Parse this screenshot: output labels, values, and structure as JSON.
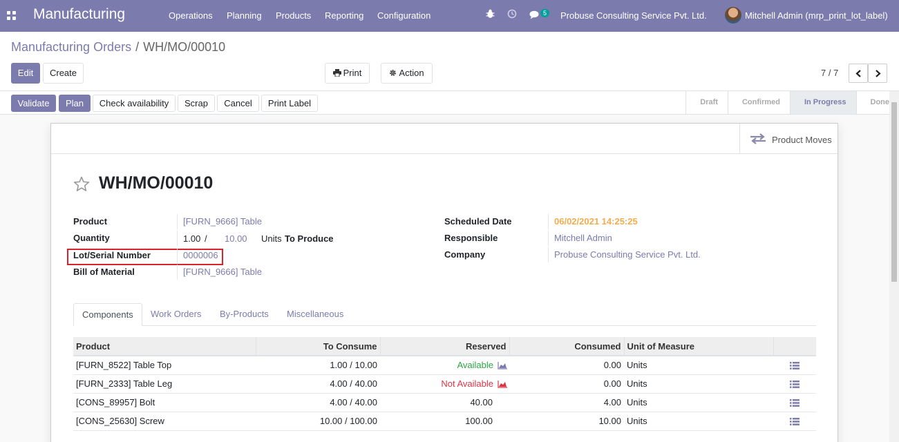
{
  "navbar": {
    "app_title": "Manufacturing",
    "menu": [
      "Operations",
      "Planning",
      "Products",
      "Reporting",
      "Configuration"
    ],
    "message_count": "5",
    "company": "Probuse Consulting Service Pvt. Ltd.",
    "user": "Mitchell Admin (mrp_print_lot_label)"
  },
  "breadcrumb": {
    "parent": "Manufacturing Orders",
    "separator": "/",
    "current": "WH/MO/00010"
  },
  "toolbar": {
    "edit": "Edit",
    "create": "Create",
    "print": "Print",
    "action": "Action",
    "pager": "7 / 7"
  },
  "statusbar": {
    "buttons": {
      "validate": "Validate",
      "plan": "Plan",
      "check_availability": "Check availability",
      "scrap": "Scrap",
      "cancel": "Cancel",
      "print_label": "Print Label"
    },
    "stages": [
      "Draft",
      "Confirmed",
      "In Progress",
      "Done"
    ],
    "active_stage": "In Progress"
  },
  "smart_button": {
    "label": "Product Moves"
  },
  "record": {
    "name": "WH/MO/00010",
    "left_fields": {
      "product_label": "Product",
      "product_value": "[FURN_9666] Table",
      "quantity_label": "Quantity",
      "qty_produced": "1.00",
      "qty_separator": "/",
      "qty_total": "10.00",
      "qty_uom": "Units",
      "qty_suffix": "To Produce",
      "lot_label": "Lot/Serial Number",
      "lot_value": "0000006",
      "bom_label": "Bill of Material",
      "bom_value": "[FURN_9666] Table"
    },
    "right_fields": {
      "scheduled_label": "Scheduled Date",
      "scheduled_value": "06/02/2021 14:25:25",
      "responsible_label": "Responsible",
      "responsible_value": "Mitchell Admin",
      "company_label": "Company",
      "company_value": "Probuse Consulting Service Pvt. Ltd."
    }
  },
  "tabs": [
    "Components",
    "Work Orders",
    "By-Products",
    "Miscellaneous"
  ],
  "components": {
    "headers": [
      "Product",
      "To Consume",
      "Reserved",
      "Consumed",
      "Unit of Measure"
    ],
    "rows": [
      {
        "product": "[FURN_8522] Table Top",
        "to_consume": "1.00 / 10.00",
        "reserved": "Available",
        "reserved_status": "available",
        "consumed": "0.00",
        "uom": "Units"
      },
      {
        "product": "[FURN_2333] Table Leg",
        "to_consume": "4.00 / 40.00",
        "reserved": "Not Available",
        "reserved_status": "unavailable",
        "consumed": "0.00",
        "uom": "Units"
      },
      {
        "product": "[CONS_89957] Bolt",
        "to_consume": "4.00 / 40.00",
        "reserved": "40.00",
        "reserved_status": "number",
        "consumed": "4.00",
        "uom": "Units"
      },
      {
        "product": "[CONS_25630] Screw",
        "to_consume": "10.00 / 100.00",
        "reserved": "100.00",
        "reserved_status": "number",
        "consumed": "10.00",
        "uom": "Units"
      }
    ]
  },
  "colors": {
    "brand": "#7c7bad",
    "date": "#f0ad4e",
    "available": "#28a745",
    "unavailable": "#dc3545",
    "highlight": "#d9232a"
  }
}
